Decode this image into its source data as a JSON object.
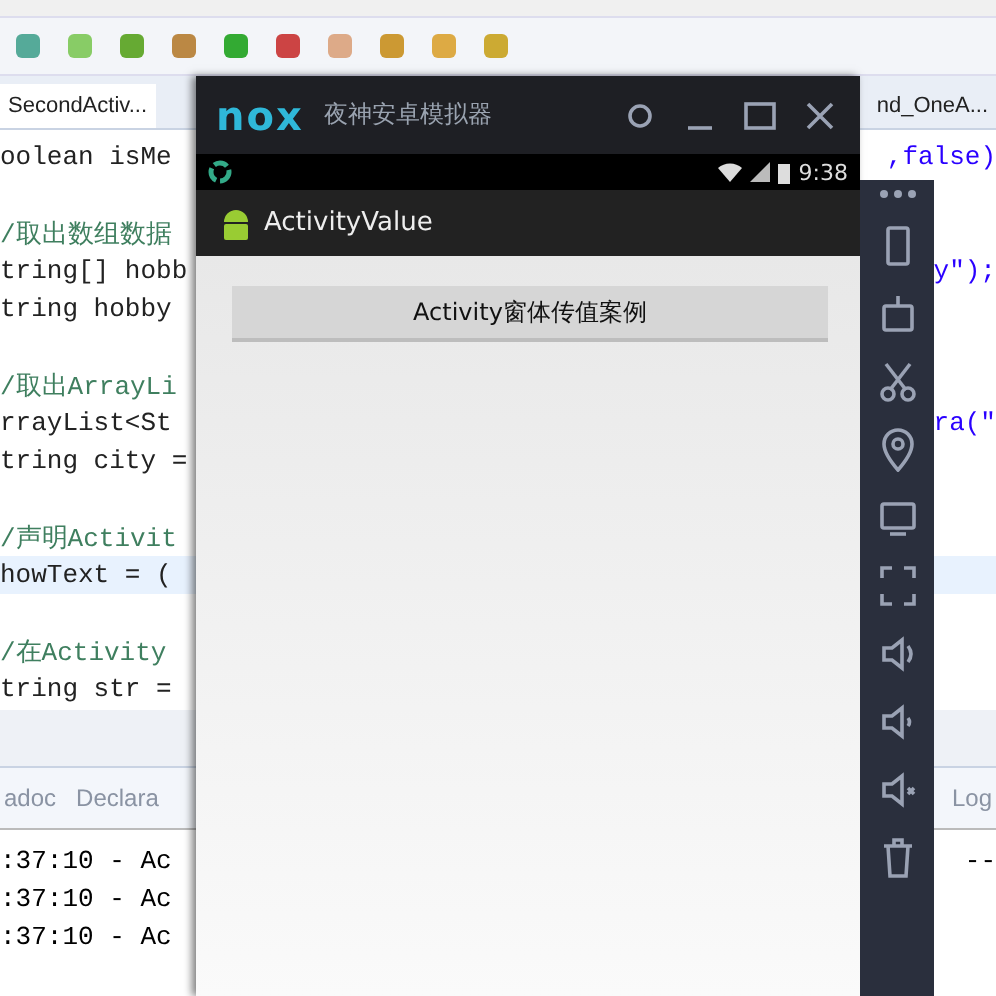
{
  "editor_tabs": [
    {
      "label": "SecondActiv...",
      "selected": true
    },
    {
      "label": "nd_OneA...",
      "selected": false
    }
  ],
  "code_lines": [
    {
      "kind": "code",
      "left": "oolean isMe",
      "right": ",false)",
      "highlighted": false
    },
    {
      "kind": "blank",
      "highlighted": false
    },
    {
      "kind": "comment",
      "left": "/取出数组数据",
      "highlighted": false
    },
    {
      "kind": "code",
      "left": "tring[] hobb",
      "right": "y\");",
      "highlighted": false
    },
    {
      "kind": "code",
      "left": "tring hobby",
      "highlighted": false
    },
    {
      "kind": "blank",
      "highlighted": false
    },
    {
      "kind": "comment",
      "left": "/取出ArrayLi",
      "highlighted": false
    },
    {
      "kind": "code",
      "left": "rrayList<St",
      "right": "ra(\"",
      "highlighted": false
    },
    {
      "kind": "code",
      "left": "tring city =",
      "highlighted": false
    },
    {
      "kind": "blank",
      "highlighted": false
    },
    {
      "kind": "comment",
      "left": "/声明Activit",
      "highlighted": false
    },
    {
      "kind": "code",
      "left": "howText = (",
      "highlighted": true
    },
    {
      "kind": "blank",
      "highlighted": false
    },
    {
      "kind": "comment",
      "left": "/在Activity",
      "highlighted": false
    },
    {
      "kind": "code",
      "left": "tring str =",
      "highlighted": false
    }
  ],
  "bottom_tabs": [
    {
      "label": "adoc"
    },
    {
      "label": "Declara"
    }
  ],
  "bottom_tab_right": "Log",
  "console_lines": [
    {
      "left": ":37:10 - Ac",
      "right": "--"
    },
    {
      "left": ":37:10 - Ac"
    },
    {
      "left": ":37:10 - Ac"
    }
  ],
  "emulator": {
    "logo": "nox",
    "title": "夜神安卓模拟器",
    "time": "9:38",
    "app_title": "ActivityValue",
    "button": "Activity窗体传值案例"
  }
}
